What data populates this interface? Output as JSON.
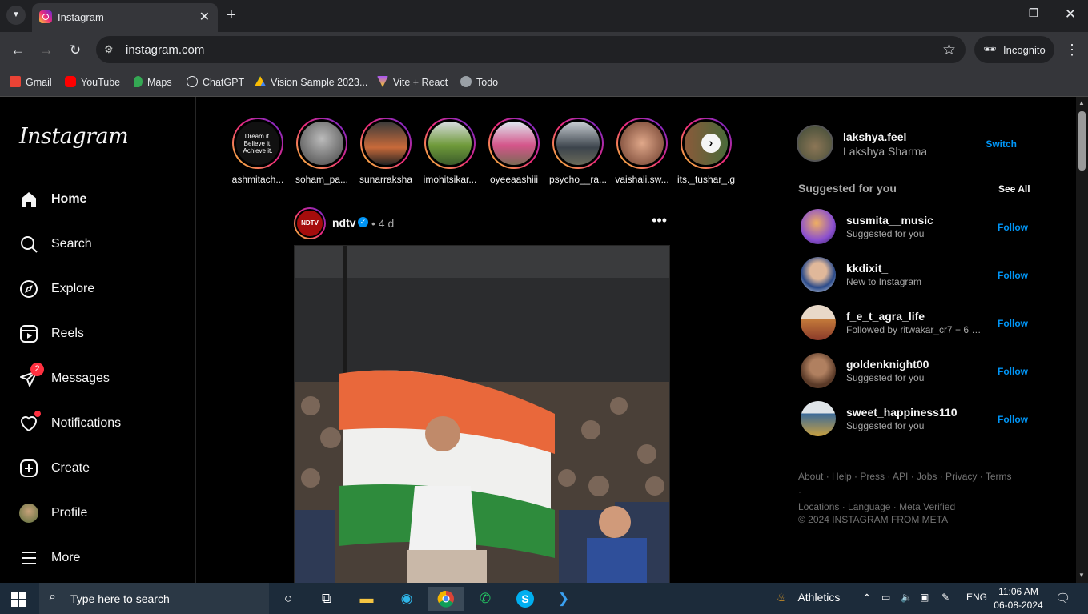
{
  "browser": {
    "tab_title": "Instagram",
    "url": "instagram.com",
    "incognito_label": "Incognito",
    "bookmarks": [
      {
        "label": "Gmail",
        "icon": "gmail-icon",
        "color": "#ea4335"
      },
      {
        "label": "YouTube",
        "icon": "youtube-icon",
        "color": "#ff0000"
      },
      {
        "label": "Maps",
        "icon": "maps-icon",
        "color": "#34a853"
      },
      {
        "label": "ChatGPT",
        "icon": "chatgpt-icon",
        "color": "#e8eaed"
      },
      {
        "label": "Vision Sample 2023...",
        "icon": "drive-icon",
        "color": "#fbbc04"
      },
      {
        "label": "Vite + React",
        "icon": "vite-icon",
        "color": "#a855f7"
      },
      {
        "label": "Todo",
        "icon": "globe-icon",
        "color": "#9aa0a6"
      }
    ]
  },
  "sidebar": {
    "logo": "Instagram",
    "items": [
      {
        "label": "Home",
        "icon": "home-icon",
        "active": true
      },
      {
        "label": "Search",
        "icon": "search-icon"
      },
      {
        "label": "Explore",
        "icon": "compass-icon"
      },
      {
        "label": "Reels",
        "icon": "reels-icon"
      },
      {
        "label": "Messages",
        "icon": "messages-icon",
        "badge": "2"
      },
      {
        "label": "Notifications",
        "icon": "heart-icon"
      },
      {
        "label": "Create",
        "icon": "plus-square-icon"
      },
      {
        "label": "Profile",
        "icon": "profile-avatar"
      },
      {
        "label": "More",
        "icon": "menu-icon"
      }
    ]
  },
  "stories": [
    {
      "name": "ashmitach...",
      "avatar_text": "Dream it. Believe it. Achieve it."
    },
    {
      "name": "soham_pa...",
      "color": "#6b6b6b"
    },
    {
      "name": "sunarraksha",
      "color": "#7a4a2e"
    },
    {
      "name": "imohitsikar...",
      "color": "#5f7d3a"
    },
    {
      "name": "oyeeaashiii",
      "color": "#b84a7a"
    },
    {
      "name": "psycho__ra...",
      "color": "#44505a"
    },
    {
      "name": "vaishali.sw...",
      "color": "#c58a6a"
    },
    {
      "name": "its._tushar_.g",
      "color": "#8a5a3a"
    }
  ],
  "post": {
    "username": "ndtv",
    "avatar_text": "NDTV",
    "time": "4 d",
    "separator": "•"
  },
  "account": {
    "username": "lakshya.feel",
    "name": "Lakshya Sharma",
    "switch_label": "Switch"
  },
  "suggestions": {
    "heading": "Suggested for you",
    "see_all": "See All",
    "follow_label": "Follow",
    "items": [
      {
        "username": "susmita__music",
        "subtitle": "Suggested for you",
        "color": "#8a4fd0"
      },
      {
        "username": "kkdixit_",
        "subtitle": "New to Instagram",
        "color": "#2a4a8a"
      },
      {
        "username": "f_e_t_agra_life",
        "subtitle": "Followed by ritwakar_cr7 + 6 more",
        "color": "#c47a3a"
      },
      {
        "username": "goldenknight00",
        "subtitle": "Suggested for you",
        "color": "#5a3a28"
      },
      {
        "username": "sweet_happiness110",
        "subtitle": "Suggested for you",
        "color": "#3a6a9a"
      }
    ]
  },
  "footer": {
    "links_line1": "About · Help · Press · API · Jobs · Privacy · Terms ·",
    "links_line2": "Locations · Language · Meta Verified",
    "copyright": "© 2024 INSTAGRAM FROM META"
  },
  "taskbar": {
    "search_placeholder": "Type here to search",
    "weather": "Athletics",
    "language": "ENG",
    "time": "11:06 AM",
    "date": "06-08-2024"
  }
}
